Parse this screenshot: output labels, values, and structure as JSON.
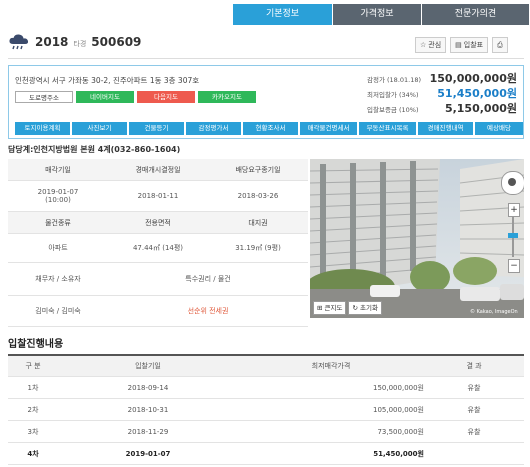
{
  "tabs": [
    {
      "label": "기본정보",
      "active": true
    },
    {
      "label": "가격정보",
      "active": false
    },
    {
      "label": "전문가의견",
      "active": false
    }
  ],
  "case": {
    "year": "2018",
    "label": "타경",
    "number": "500609",
    "icon": "cloud-rain-icon"
  },
  "header_buttons": [
    {
      "label": "관심",
      "icon": "star-icon"
    },
    {
      "label": "입찰표",
      "icon": "document-icon"
    },
    {
      "label": "",
      "icon": "print-icon"
    }
  ],
  "address": "인천광역시 서구 가좌동 30-2, 진주아파트 1동 3층 307호",
  "map_buttons": [
    "도로명주소",
    "네이버지도",
    "다음지도",
    "카카오지도"
  ],
  "prices": [
    {
      "label": "감정가 (18.01.18)",
      "value": "150,000,000원"
    },
    {
      "label": "최저입찰가 (34%)",
      "value": "51,450,000원"
    },
    {
      "label": "입찰보증금 (10%)",
      "value": "5,150,000원"
    }
  ],
  "actions": [
    "토지이용계획",
    "사진보기",
    "건물등기",
    "감정평가서",
    "현황조사서",
    "매각물건명세서",
    "부동산표시목록",
    "경매진행내역",
    "예상배당"
  ],
  "court": "담당계:인천지방법원 본원 4계(032-860-1604)",
  "detail": {
    "row1_headers": [
      "매각기일",
      "경매개시결정일",
      "배당요구종기일"
    ],
    "row1_values": [
      "2019-01-07\n(10:00)",
      "2018-01-11",
      "2018-03-26"
    ],
    "row2_headers": [
      "물건종류",
      "전용면적",
      "대지권"
    ],
    "row2_values": [
      "아파트",
      "47.44㎡ (14평)",
      "31.19㎡ (9평)"
    ],
    "row3_headers": [
      "채무자 / 소유자",
      "특수권리 / 물건"
    ],
    "row3_values": [
      "김미숙 / 김미숙",
      "선순위 전세권"
    ]
  },
  "photo": {
    "map_btn": "큰지도",
    "zoom_btn": "초기화",
    "credit": "© Kakao, ImageOn"
  },
  "history": {
    "title": "입찰진행내용",
    "headers": [
      "구 분",
      "입찰기일",
      "최저매각가격",
      "결 과"
    ],
    "rows": [
      [
        "1차",
        "2018-09-14",
        "150,000,000원",
        "유찰"
      ],
      [
        "2차",
        "2018-10-31",
        "105,000,000원",
        "유찰"
      ],
      [
        "3차",
        "2018-11-29",
        "73,500,000원",
        "유찰"
      ],
      [
        "4차",
        "2019-01-07",
        "51,450,000원",
        ""
      ]
    ]
  },
  "colors": {
    "accent": "#2aa0d8",
    "dark_tab": "#5a6570",
    "blue_price": "#1a7ec8",
    "red_text": "#e05a3c"
  }
}
